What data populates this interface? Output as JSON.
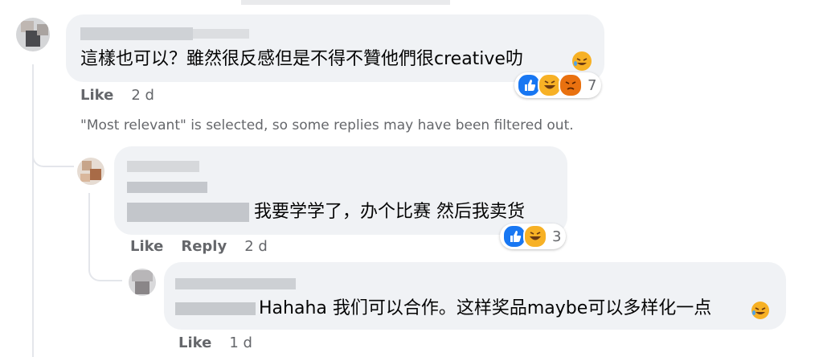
{
  "comment": {
    "text": "這樣也可以？雖然很反感但是不得不贊他們很creative叻",
    "like_label": "Like",
    "time": "2 d",
    "reaction_count": "7",
    "reaction_icons": [
      "like-icon",
      "haha-icon",
      "angry-icon"
    ]
  },
  "filter_note": "\"Most relevant\" is selected, so some replies may have been filtered out.",
  "reply1": {
    "text": "我要学学了，办个比赛 然后我卖货",
    "like_label": "Like",
    "reply_label": "Reply",
    "time": "2 d",
    "reaction_count": "3",
    "reaction_icons": [
      "like-icon",
      "haha-icon"
    ]
  },
  "reply2": {
    "text": "Hahaha 我们可以合作。这样奖品maybe可以多样化一点",
    "like_label": "Like",
    "time": "1 d"
  },
  "colors": {
    "bubble": "#f0f2f5",
    "secondary_text": "#65676b",
    "like_blue": "#1877f2",
    "haha_yellow": "#f7b125",
    "angry_orange": "#e9710f"
  }
}
